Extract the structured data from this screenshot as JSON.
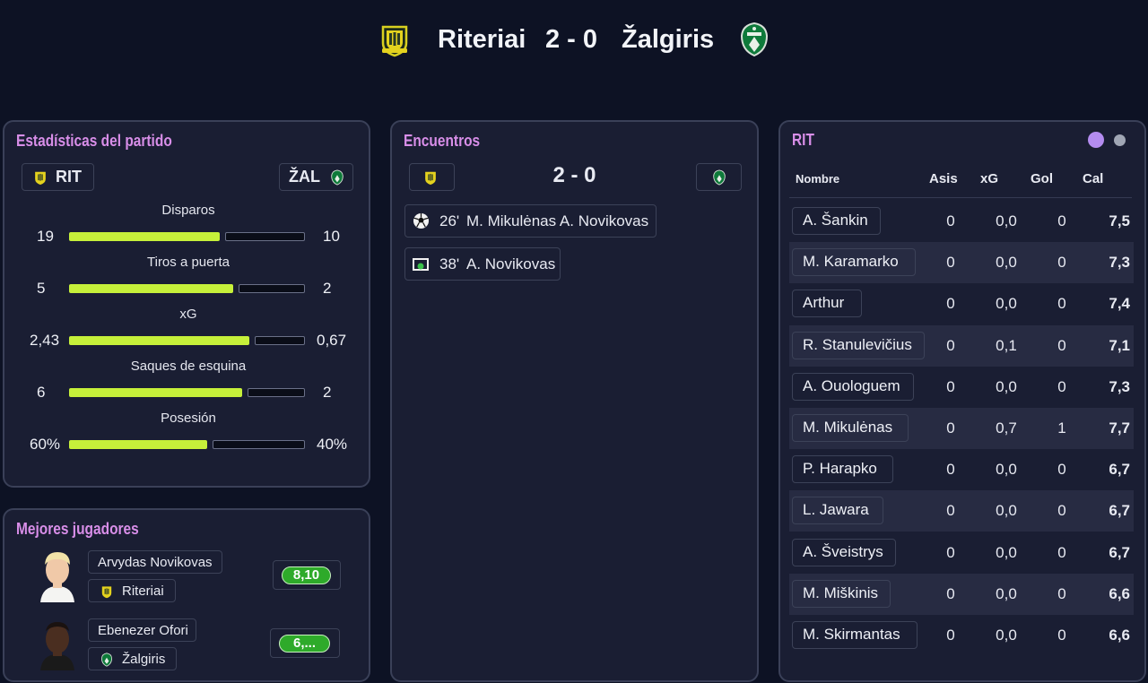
{
  "header": {
    "home_team": "Riteriai",
    "score": "2 - 0",
    "away_team": "Žalgiris"
  },
  "stats_panel": {
    "title": "Estadísticas del partido",
    "home_abbr": "RIT",
    "away_abbr": "ŽAL",
    "stats": [
      {
        "label": "Disparos",
        "home": "19",
        "away": "10",
        "home_fraction": 0.655
      },
      {
        "label": "Tiros a puerta",
        "home": "5",
        "away": "2",
        "home_fraction": 0.714
      },
      {
        "label": "xG",
        "home": "2,43",
        "away": "0,67",
        "home_fraction": 0.784
      },
      {
        "label": "Saques de esquina",
        "home": "6",
        "away": "2",
        "home_fraction": 0.75
      },
      {
        "label": "Posesión",
        "home": "60%",
        "away": "40%",
        "home_fraction": 0.6
      }
    ]
  },
  "best_players_panel": {
    "title": "Mejores jugadores",
    "players": [
      {
        "name": "Arvydas Novikovas",
        "team": "Riteriai",
        "rating": "8,10"
      },
      {
        "name": "Ebenezer Ofori",
        "team": "Žalgiris",
        "rating": "6,..."
      }
    ]
  },
  "events_panel": {
    "title": "Encuentros",
    "score": "2 - 0",
    "events": [
      {
        "minute": "26'",
        "text": "M. Mikulėnas A. Novikovas",
        "icon": "soccer-ball-icon"
      },
      {
        "minute": "38'",
        "text": "A. Novikovas",
        "icon": "goal-net-icon"
      }
    ]
  },
  "lineup_panel": {
    "title": "RIT",
    "columns": {
      "name": "Nombre",
      "assists": "Asis",
      "xg": "xG",
      "goals": "Gol",
      "rating": "Cal"
    },
    "players": [
      {
        "name": "A. Šankin",
        "assists": "0",
        "xg": "0,0",
        "goals": "0",
        "rating": "7,5"
      },
      {
        "name": "M. Karamarko",
        "assists": "0",
        "xg": "0,0",
        "goals": "0",
        "rating": "7,3"
      },
      {
        "name": "Arthur",
        "assists": "0",
        "xg": "0,0",
        "goals": "0",
        "rating": "7,4"
      },
      {
        "name": "R. Stanulevičius",
        "assists": "0",
        "xg": "0,1",
        "goals": "0",
        "rating": "7,1"
      },
      {
        "name": "A. Ouologuem",
        "assists": "0",
        "xg": "0,0",
        "goals": "0",
        "rating": "7,3"
      },
      {
        "name": "M. Mikulėnas",
        "assists": "0",
        "xg": "0,7",
        "goals": "1",
        "rating": "7,7"
      },
      {
        "name": "P. Harapko",
        "assists": "0",
        "xg": "0,0",
        "goals": "0",
        "rating": "6,7"
      },
      {
        "name": "L. Jawara",
        "assists": "0",
        "xg": "0,0",
        "goals": "0",
        "rating": "6,7"
      },
      {
        "name": "A. Šveistrys",
        "assists": "0",
        "xg": "0,0",
        "goals": "0",
        "rating": "6,7"
      },
      {
        "name": "M. Miškinis",
        "assists": "0",
        "xg": "0,0",
        "goals": "0",
        "rating": "6,6"
      },
      {
        "name": "M. Skirmantas",
        "assists": "0",
        "xg": "0,0",
        "goals": "0",
        "rating": "6,6"
      }
    ]
  },
  "colors": {
    "accent_title": "#d88ee8",
    "home_bar": "#c6f03a",
    "rating_pill": "#2eaa2a",
    "page_dot_active": "#b48cf0",
    "page_dot_inactive": "#a0a6b4"
  }
}
